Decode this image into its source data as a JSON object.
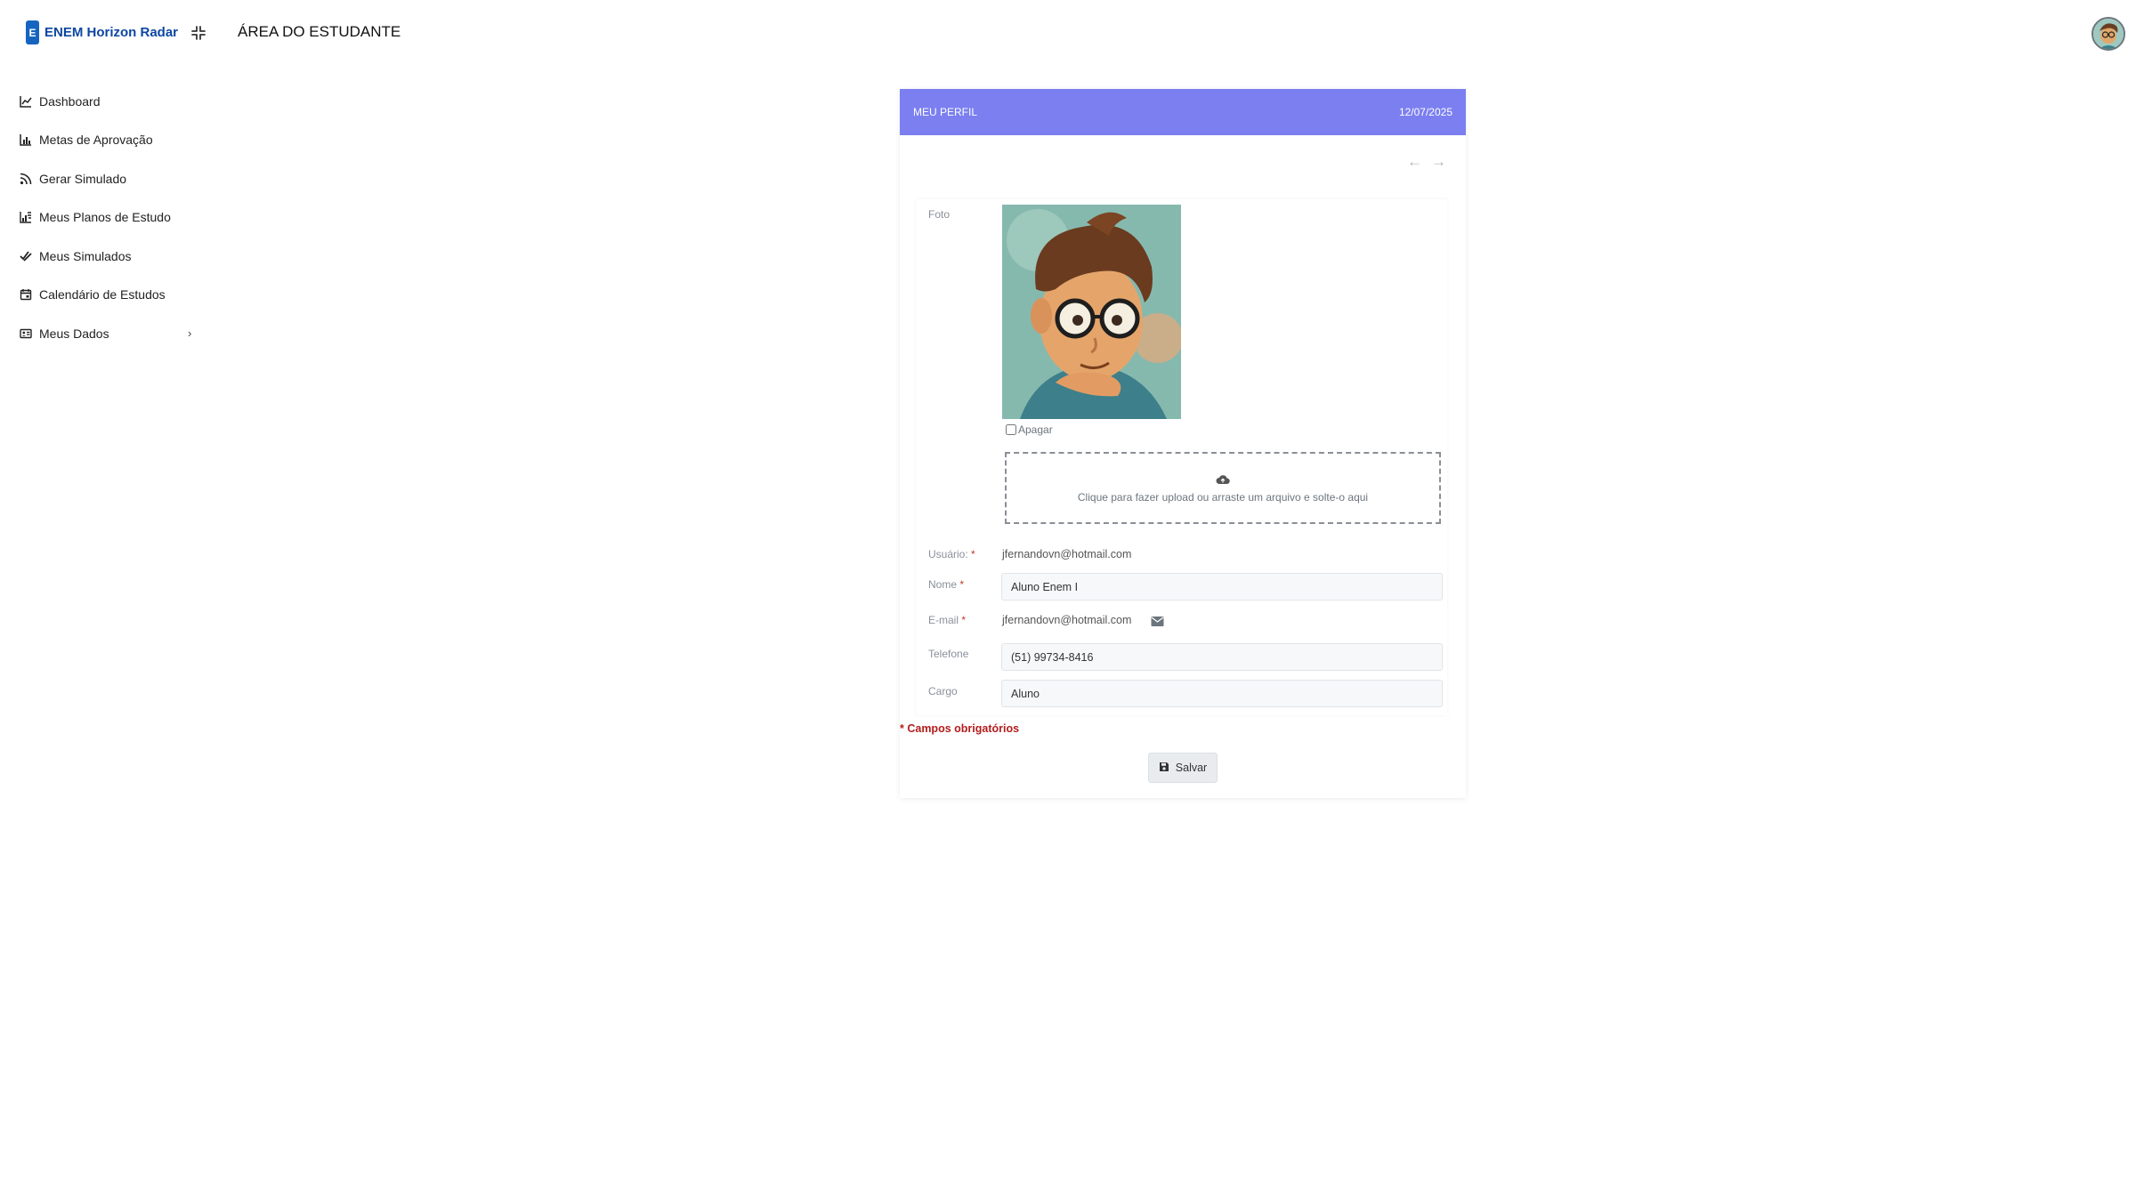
{
  "header": {
    "logo_letter": "E",
    "brand": "ENEM Horizon Radar",
    "title": "ÁREA DO ESTUDANTE"
  },
  "sidebar": {
    "items": [
      {
        "label": "Dashboard",
        "icon": "line-chart-icon"
      },
      {
        "label": "Metas de Aprovação",
        "icon": "bar-chart-icon"
      },
      {
        "label": "Gerar Simulado",
        "icon": "rss-icon"
      },
      {
        "label": "Meus Planos de Estudo",
        "icon": "chart-list-icon"
      },
      {
        "label": "Meus Simulados",
        "icon": "check-double-icon"
      },
      {
        "label": "Calendário de Estudos",
        "icon": "calendar-icon"
      },
      {
        "label": "Meus Dados",
        "icon": "id-card-icon",
        "chevron": "›"
      }
    ]
  },
  "card": {
    "title": "MEU PERFIL",
    "date": "12/07/2025",
    "arrows": {
      "prev": "←",
      "next": "→"
    }
  },
  "form": {
    "foto_label": "Foto",
    "delete_label": "Apagar",
    "upload_text": "Clique para fazer upload ou arraste um arquivo e solte-o aqui",
    "usuario_label": "Usuário:",
    "usuario_value": "jfernandovn@hotmail.com",
    "nome_label": "Nome",
    "nome_value": "Aluno Enem I",
    "email_label": "E-mail",
    "email_value": "jfernandovn@hotmail.com",
    "telefone_label": "Telefone",
    "telefone_value": "(51) 99734-8416",
    "cargo_label": "Cargo",
    "cargo_value": "Aluno",
    "required_mark": "*"
  },
  "footer": {
    "required_note": "* Campos obrigatórios",
    "save_label": "Salvar"
  },
  "colors": {
    "card_header": "#7b7ff0",
    "brand": "#0d47a1",
    "required": "#b31d1d"
  }
}
